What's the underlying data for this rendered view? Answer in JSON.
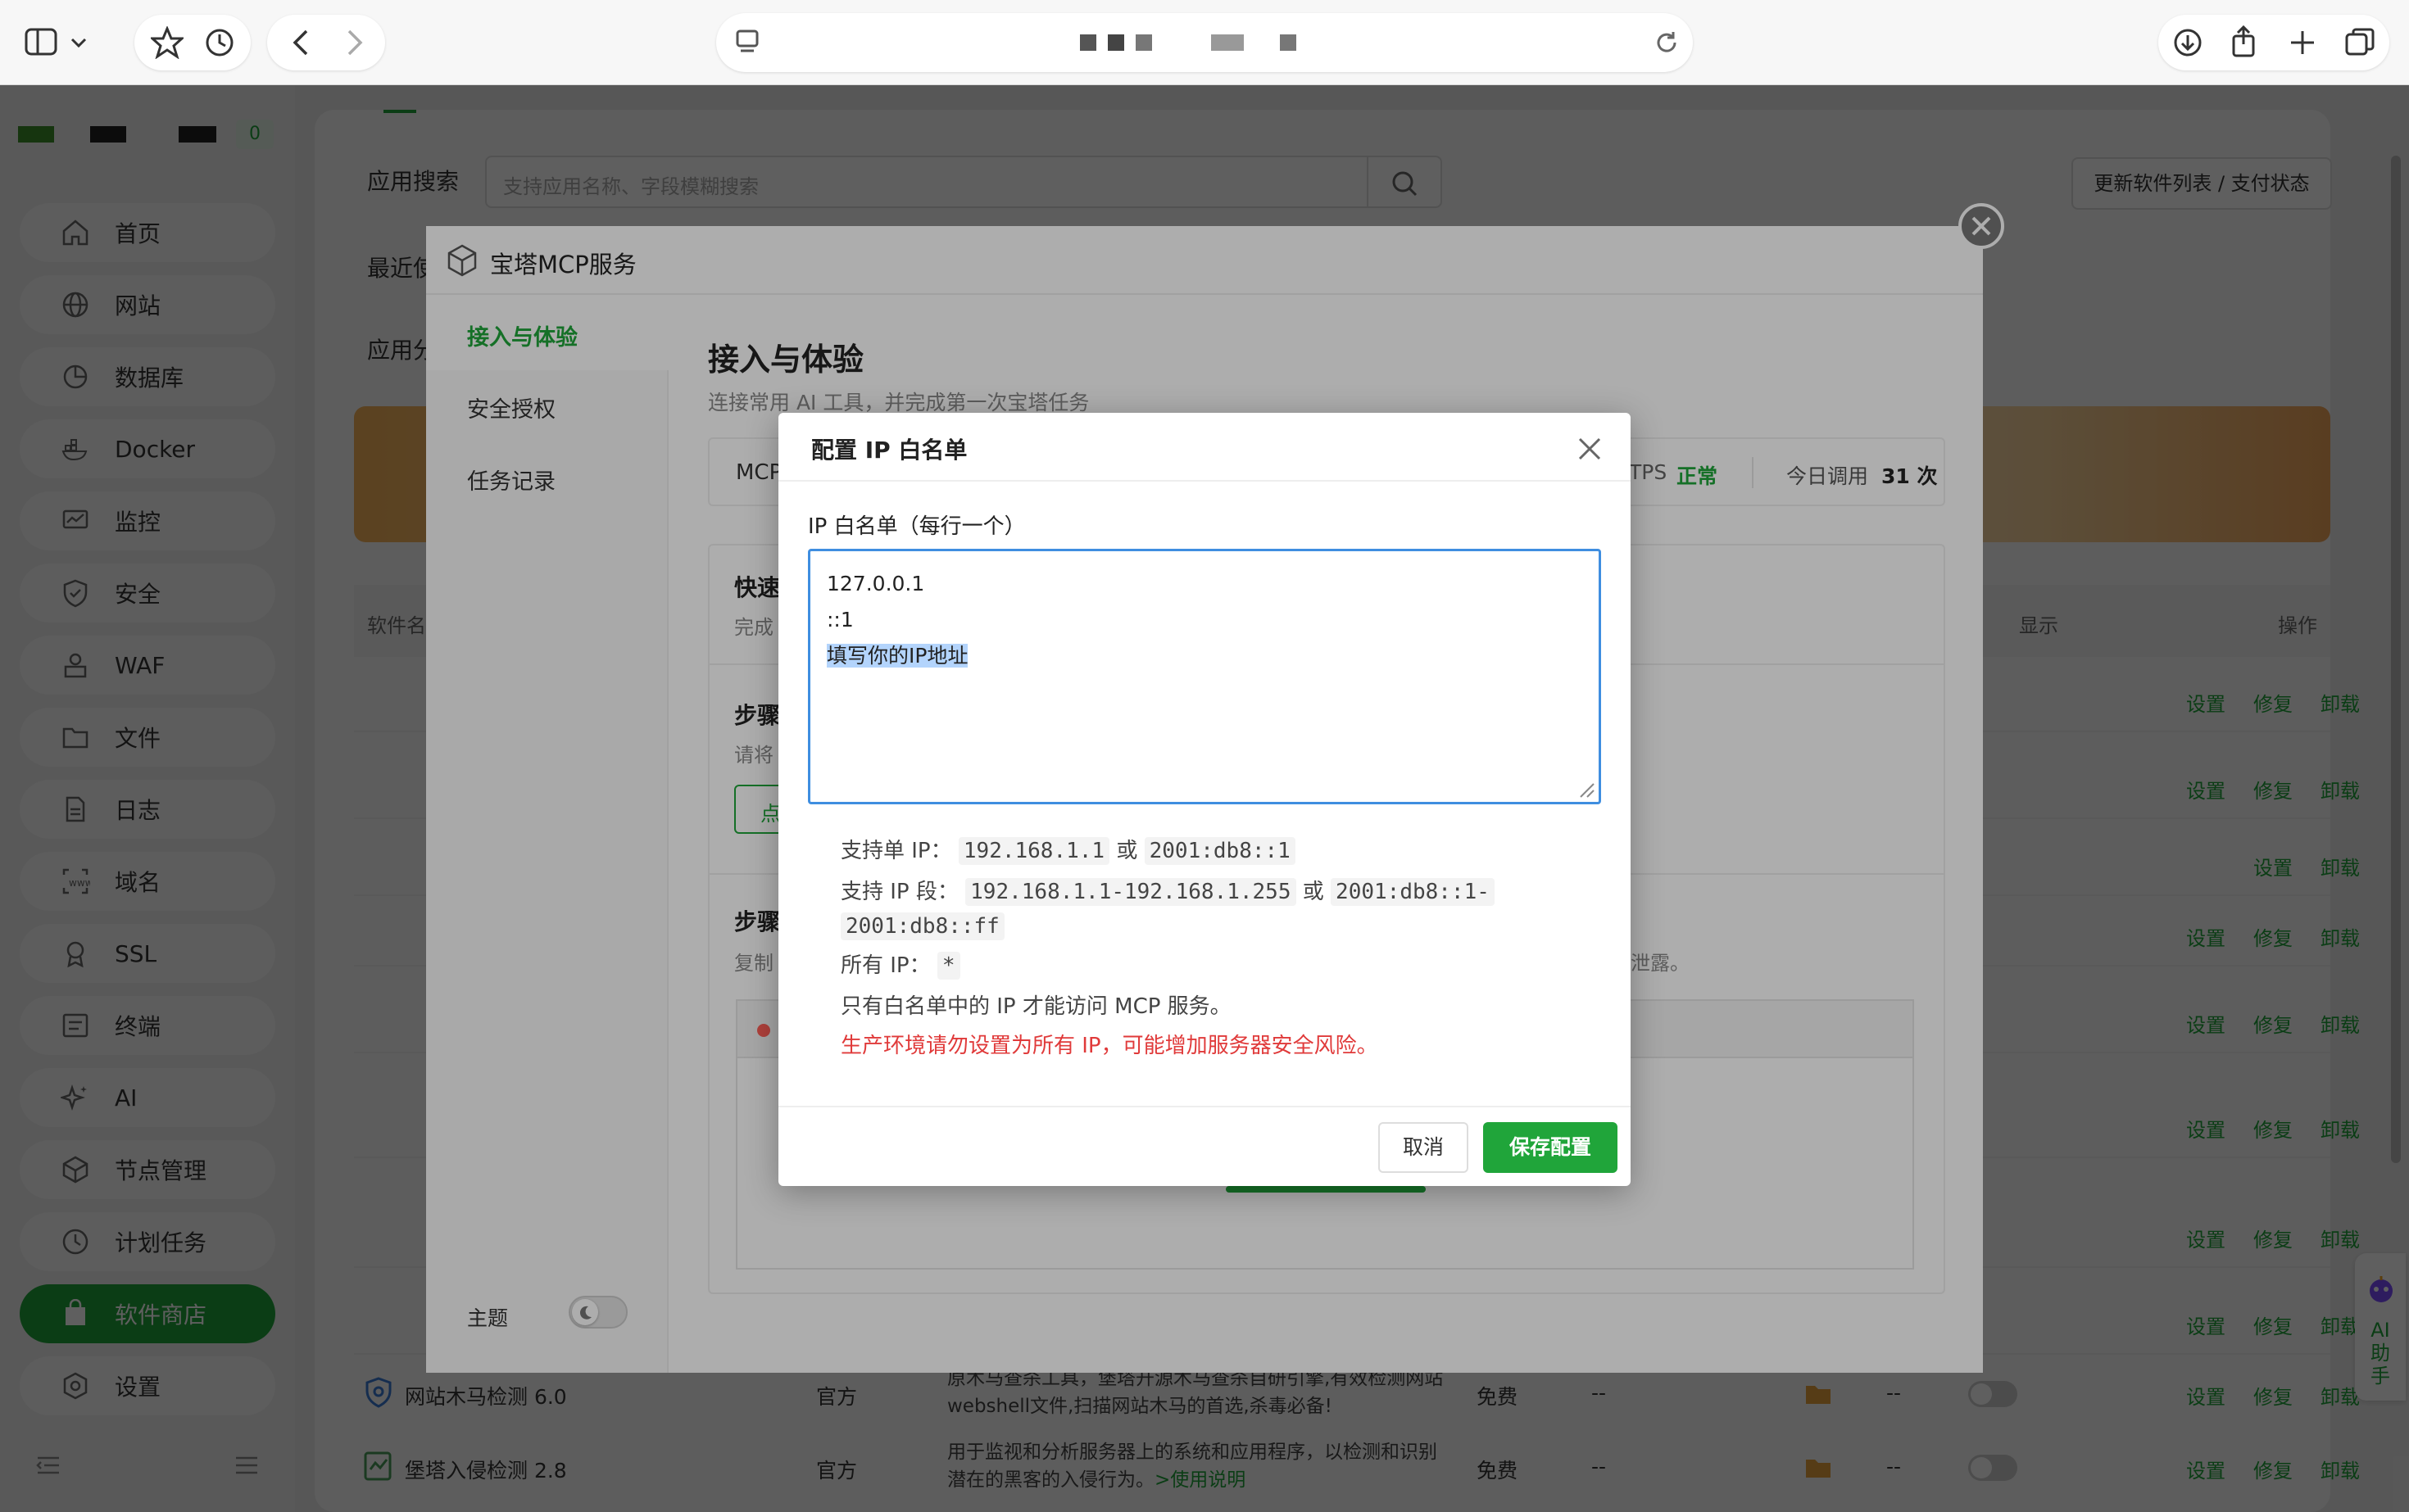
{
  "sidebar": {
    "badge": "0",
    "items": [
      {
        "label": "首页",
        "icon": "home-icon"
      },
      {
        "label": "网站",
        "icon": "globe-icon"
      },
      {
        "label": "数据库",
        "icon": "database-icon"
      },
      {
        "label": "Docker",
        "icon": "docker-icon"
      },
      {
        "label": "监控",
        "icon": "monitor-icon"
      },
      {
        "label": "安全",
        "icon": "shield-icon"
      },
      {
        "label": "WAF",
        "icon": "waf-icon"
      },
      {
        "label": "文件",
        "icon": "folder-icon"
      },
      {
        "label": "日志",
        "icon": "log-icon"
      },
      {
        "label": "域名",
        "icon": "domain-icon"
      },
      {
        "label": "SSL",
        "icon": "ssl-icon"
      },
      {
        "label": "终端",
        "icon": "terminal-icon"
      },
      {
        "label": "AI",
        "icon": "ai-sparkle-icon"
      },
      {
        "label": "节点管理",
        "icon": "node-icon"
      },
      {
        "label": "计划任务",
        "icon": "clock-icon"
      },
      {
        "label": "软件商店",
        "icon": "store-icon"
      },
      {
        "label": "设置",
        "icon": "gear-icon"
      }
    ]
  },
  "main": {
    "search_label": "应用搜索",
    "search_placeholder": "支持应用名称、字段模糊搜索",
    "update_button": "更新软件列表 / 支付状态",
    "recent_label": "最近使",
    "category_label": "应用分",
    "col_name": "软件名",
    "col_show": "显示",
    "col_ops": "操作",
    "op_settings": "设置",
    "op_repair": "修复",
    "op_uninstall": "卸载",
    "rows": [
      {
        "name": "网站木马检测 6.0",
        "vendor": "官方",
        "desc": "原木马查杀工具，堡塔开源木马查杀自研引擎,有效检测网站webshell文件,扫描网站木马的首选,杀毒必备!",
        "price": "免费",
        "dash": "--"
      },
      {
        "name": "堡塔入侵检测 2.8",
        "vendor": "官方",
        "desc": "用于监视和分析服务器上的系统和应用程序，以检测和识别潜在的黑客的入侵行为。",
        "link": ">使用说明",
        "price": "免费",
        "dash": "--"
      }
    ],
    "ai_assistant": "AI助手"
  },
  "mcp": {
    "title": "宝塔MCP服务",
    "nav": [
      "接入与体验",
      "安全授权",
      "任务记录"
    ],
    "theme_label": "主题",
    "heading": "接入与体验",
    "subheading": "连接常用 AI 工具，并完成第一次宝塔任务",
    "status_prefix": "MCP",
    "https_label": "TPS",
    "status_ok": "正常",
    "calls_label": "今日调用",
    "calls_count": "31 次",
    "quick_title": "快速",
    "quick_desc": "完成",
    "step1_title": "步骤",
    "step1_desc": "请将",
    "step1_btn": "点",
    "step2_title": "步骤",
    "step2_desc": "复制",
    "step2_tail": "泄露。"
  },
  "dialog": {
    "title": "配置 IP 白名单",
    "field_label": "IP 白名单（每行一个）",
    "lines": [
      "127.0.0.1",
      "::1",
      "填写你的IP地址"
    ],
    "hint1_label": "支持单 IP：",
    "hint1_a": "192.168.1.1",
    "hint_or": "或",
    "hint1_b": "2001:db8::1",
    "hint2_label": "支持 IP 段：",
    "hint2_a": "192.168.1.1-192.168.1.255",
    "hint2_b": "2001:db8::1-",
    "hint2_c": "2001:db8::ff",
    "hint3_label": "所有 IP：",
    "hint3_val": "*",
    "hint4": "只有白名单中的 IP 才能访问 MCP 服务。",
    "warn": "生产环境请勿设置为所有 IP，可能增加服务器安全风险。",
    "cancel": "取消",
    "save": "保存配置"
  },
  "colors": {
    "accent": "#20a53a",
    "danger": "#e03a3a"
  }
}
